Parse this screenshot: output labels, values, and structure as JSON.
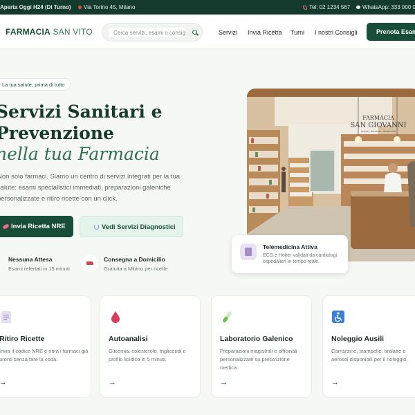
{
  "topbar": {
    "hours": "Aperta Oggi H24 (Di Turno)",
    "address": "Via Torino 45, Milano",
    "phone": "Tel: 02 1234 567",
    "whatsapp": "WhatsApp: 333 000 0"
  },
  "header": {
    "logo_main": "FARMACIA",
    "logo_accent": "SAN VITO",
    "search_placeholder": "Cerca servizi, esami o consigli...",
    "nav": [
      "Servizi",
      "Invia Ricetta",
      "Turni",
      "I nostri Consigli"
    ],
    "cta": "Prenota Esame"
  },
  "hero": {
    "tag": "La tua salute, prima di tutto",
    "title_line1": "Servizi Sanitari e",
    "title_line2": "Prevenzione",
    "title_line3": "nella tua Farmacia",
    "description": [
      "Non solo farmaci. Siamo un centro di servizi integrati per la tua",
      "salute: esami specialistici immediati, preparazioni galeniche",
      "personalizzate e ritiro ricette con un click."
    ],
    "btn_primary": "Invia Ricetta NRE",
    "btn_secondary": "Vedi Servizi Diagnostici",
    "features": [
      {
        "title": "Nessuna Attesa",
        "desc": "Esami refertati in 15 minuti"
      },
      {
        "title": "Consegna a Domicilio",
        "desc": "Gratuita a Milano per ricette"
      }
    ],
    "photo_sign_line1": "FARMACIA",
    "photo_sign_line2": "SAN GIOVANNI",
    "photo_sign_line3": "SALUTE · BELLEZZA · BENESSERE",
    "telemedicine": {
      "title": "Telemedicina Attiva",
      "desc_line1": "ECG e Holter validati da cardiologi",
      "desc_line2": "ospedalieri in tempo reale."
    }
  },
  "cards": [
    {
      "icon": "document-icon",
      "title": "Ritiro Ricette",
      "desc": [
        "Invia il codice NRE e ritira i farmaci già",
        "pronti senza fare la coda."
      ]
    },
    {
      "icon": "blood-drop-icon",
      "title": "Autoanalisi",
      "desc": [
        "Glicemia, colesterolo, trigliceridi e",
        "profilo lipidico in 5 minuti."
      ]
    },
    {
      "icon": "test-tube-icon",
      "title": "Laboratorio Galenico",
      "desc": [
        "Preparazioni magistrali e officinali",
        "personalizzate su prescrizione",
        "medica."
      ]
    },
    {
      "icon": "wheelchair-icon",
      "title": "Noleggio Ausili",
      "desc": [
        "Carrozzine, stampelle, tiralatte e",
        "aerosol disponibili per il noleggio."
      ]
    }
  ],
  "colors": {
    "primary": "#184e37",
    "accent_light": "#e4f4ea",
    "topbar": "#133a2c"
  }
}
